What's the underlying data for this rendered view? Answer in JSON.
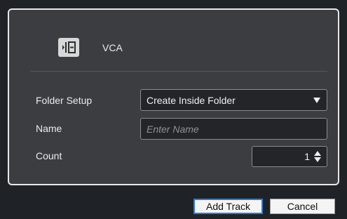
{
  "track": {
    "type_label": "VCA",
    "icon": "vca-folder-icon"
  },
  "form": {
    "folder_setup": {
      "label": "Folder Setup",
      "value": "Create Inside Folder"
    },
    "name": {
      "label": "Name",
      "value": "",
      "placeholder": "Enter Name"
    },
    "count": {
      "label": "Count",
      "value": "1"
    }
  },
  "buttons": {
    "add_track": "Add Track",
    "cancel": "Cancel"
  },
  "colors": {
    "panel_bg": "#3b3d41",
    "window_bg": "#1f2327",
    "field_bg": "#232528",
    "focus_border": "#2f7bd6"
  }
}
